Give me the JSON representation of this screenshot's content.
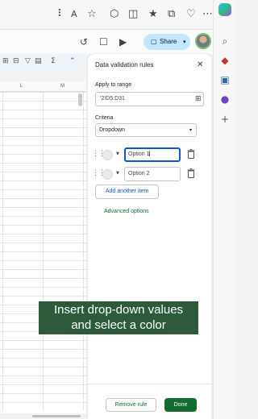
{
  "sheets_header": {
    "share_label": "Share"
  },
  "grid": {
    "columns": [
      "L",
      "M"
    ]
  },
  "panel": {
    "title": "Data validation rules",
    "apply_to_range_label": "Apply to range",
    "range_value": "'2!D5:D31",
    "criteria_label": "Criteria",
    "criteria_value": "Dropdown",
    "options": [
      {
        "value": "Option 1",
        "color": "#e8eaed",
        "focused": true
      },
      {
        "value": "Option 2",
        "color": "#e8eaed",
        "focused": false
      }
    ],
    "add_item_label": "Add another item",
    "advanced_options_label": "Advanced options",
    "remove_rule_label": "Remove rule",
    "done_label": "Done"
  },
  "caption": {
    "line1": "Insert drop-down values",
    "line2": "and select a color"
  },
  "colors": {
    "accent_green": "#146c2e",
    "share_blue": "#c2e7ff",
    "focus_blue": "#0b57d0",
    "caption_bg": "#2d5a3a"
  }
}
